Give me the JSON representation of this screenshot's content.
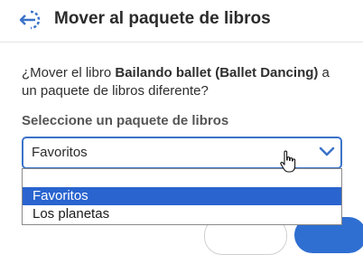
{
  "dialog": {
    "title": "Mover al paquete de libros",
    "message_prefix": "¿Mover el libro ",
    "book_title": "Bailando ballet (Ballet Dancing)",
    "message_suffix": " a un paquete de libros diferente?",
    "select_label": "Seleccione un paquete de libros",
    "select_value": "Favoritos",
    "options": [
      "Favoritos",
      "Los planetas"
    ],
    "selected_option_index": 0
  },
  "icons": {
    "back": "move-back-icon",
    "chevron": "chevron-down-icon",
    "cursor": "hand-pointer-icon"
  },
  "colors": {
    "accent": "#3b73c8",
    "selection": "#2964cf",
    "primary_button": "#2f6fd1"
  }
}
